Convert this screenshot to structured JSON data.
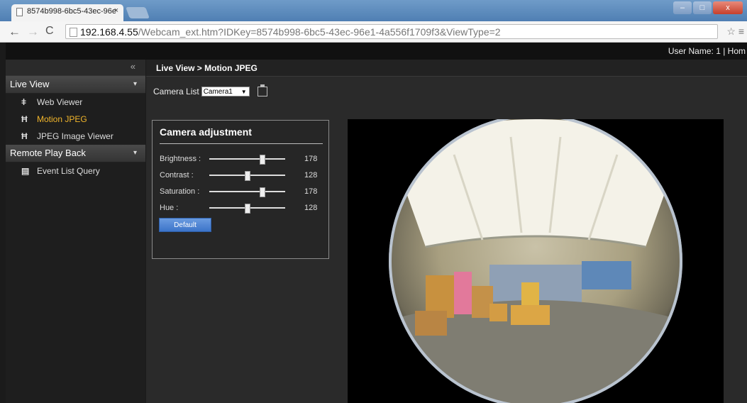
{
  "browser": {
    "tab_title": "8574b998-6bc5-43ec-96e",
    "tab_close": "×",
    "url_host": "192.168.4.55",
    "url_path": "/Webcam_ext.htm?IDKey=8574b998-6bc5-43ec-96e1-4a556f1709f3&ViewType=2"
  },
  "topbar": {
    "user": "User Name: 1 | Hom"
  },
  "sidebar": {
    "collapse": "«",
    "sections": [
      {
        "label": "Live View",
        "items": [
          {
            "label": "Web Viewer",
            "icon": "wireless-icon"
          },
          {
            "label": "Motion JPEG",
            "icon": "film-icon",
            "active": true
          },
          {
            "label": "JPEG Image Viewer",
            "icon": "film-icon"
          }
        ]
      },
      {
        "label": "Remote Play Back",
        "items": [
          {
            "label": "Event List Query",
            "icon": "document-icon"
          }
        ]
      }
    ]
  },
  "breadcrumb": "Live View > Motion JPEG",
  "camera_list": {
    "label": "Camera List",
    "selected": "Camera1"
  },
  "adjustment": {
    "title": "Camera adjustment",
    "sliders": [
      {
        "label": "Brightness :",
        "value": "178",
        "level": 0.7
      },
      {
        "label": "Contrast :",
        "value": "128",
        "level": 0.5
      },
      {
        "label": "Saturation :",
        "value": "178",
        "level": 0.7
      },
      {
        "label": "Hue :",
        "value": "128",
        "level": 0.5
      }
    ],
    "default_button": "Default"
  },
  "colors": {
    "accent": "#f1b52b",
    "button": "#3c74c9"
  }
}
